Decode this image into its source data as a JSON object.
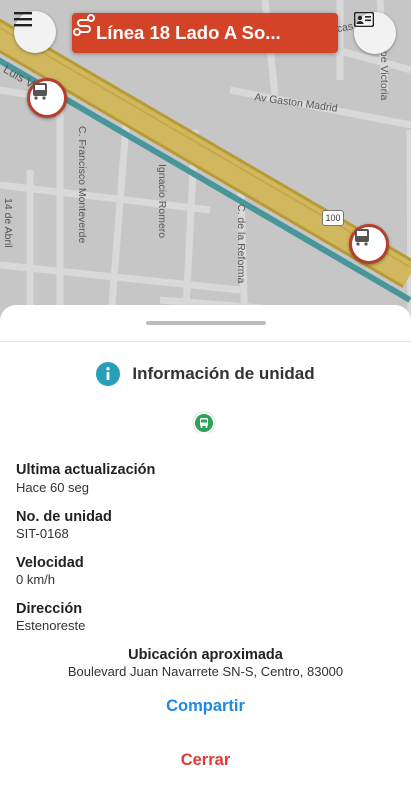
{
  "map": {
    "streets": [
      "Luis Viñas J.",
      "Av. Zacatecas",
      "Ipe Victoria",
      "Av Gaston Madrid",
      "C. Francisco Monteverde",
      "Ignacio Romero",
      "C. de la Reforma",
      "14 de Abril"
    ],
    "road_shield": "100"
  },
  "header": {
    "route_title": "Línea 18 Lado A So...",
    "menu_icon": "menu-icon",
    "route_icon": "route-icon",
    "card_icon": "id-card-icon"
  },
  "sheet": {
    "title": "Información de unidad",
    "fields": [
      {
        "label": "Ultima actualización",
        "value": "Hace 60 seg"
      },
      {
        "label": "No. de unidad",
        "value": "SIT-0168"
      },
      {
        "label": "Velocidad",
        "value": "0 km/h"
      },
      {
        "label": "Dirección",
        "value": "Estenoreste"
      }
    ],
    "location_label": "Ubicación aproximada",
    "location_value": "Boulevard Juan Navarrete SN-S, Centro, 83000",
    "share_label": "Compartir",
    "close_label": "Cerrar"
  },
  "colors": {
    "accent_blue": "#1e88e5",
    "close_red": "#e53935",
    "banner": "#d24327",
    "info_teal": "#26a0b8",
    "bus_green": "#2fa257"
  }
}
